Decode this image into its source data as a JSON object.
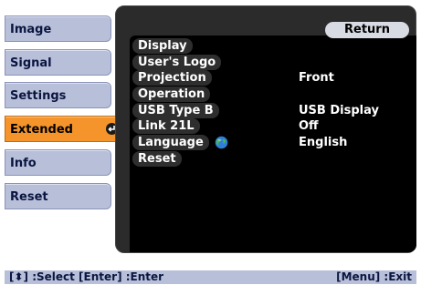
{
  "tabs": [
    {
      "label": "Image",
      "active": false
    },
    {
      "label": "Signal",
      "active": false
    },
    {
      "label": "Settings",
      "active": false
    },
    {
      "label": "Extended",
      "active": true
    },
    {
      "label": "Info",
      "active": false
    },
    {
      "label": "Reset",
      "active": false
    }
  ],
  "return_label": "Return",
  "items": [
    {
      "label": "Display",
      "value": ""
    },
    {
      "label": "User's Logo",
      "value": ""
    },
    {
      "label": "Projection",
      "value": "Front"
    },
    {
      "label": "Operation",
      "value": ""
    },
    {
      "label": "USB Type B",
      "value": "USB Display"
    },
    {
      "label": "Link 21L",
      "value": "Off"
    },
    {
      "label": "Language",
      "value": "English",
      "icon": "globe-icon"
    },
    {
      "label": "Reset",
      "value": ""
    }
  ],
  "help": {
    "left": "[⬍] :Select  [Enter] :Enter",
    "right": "[Menu] :Exit"
  },
  "colors": {
    "tab_bg": "#b8bfd9",
    "tab_active_bg": "#f4942a",
    "panel_bg": "#000000",
    "text_light": "#ffffff"
  }
}
